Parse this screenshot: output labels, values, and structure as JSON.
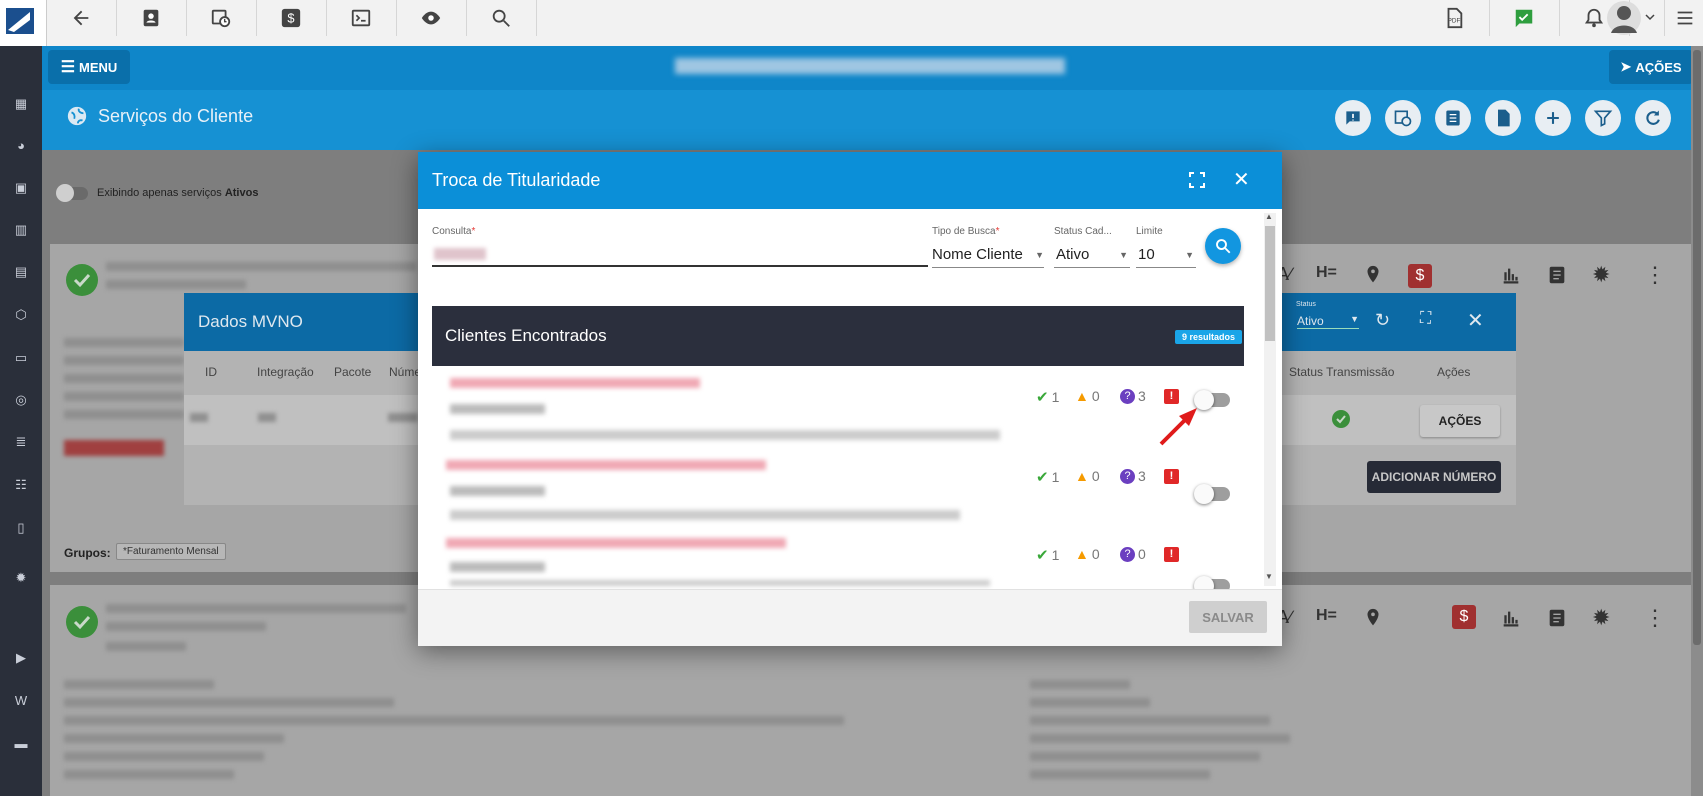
{
  "toolbar": {
    "icons": [
      "back-arrow-icon",
      "contact-card-icon",
      "calendar-clock-icon",
      "dollar-icon",
      "terminal-icon",
      "eye-icon",
      "search-icon"
    ],
    "right_icons": [
      "pdf-icon",
      "chat-check-icon",
      "bell-icon",
      "avatar",
      "menu-list-icon"
    ]
  },
  "header": {
    "menu_label": "MENU",
    "acoes_label": "AÇÕES",
    "page_title": "Serviços do Cliente"
  },
  "filter": {
    "toggle_text": "Exibindo apenas serviços",
    "toggle_bold": "Ativos"
  },
  "groups": {
    "label": "Grupos:",
    "tag": "*Faturamento Mensal"
  },
  "mvno": {
    "title": "Dados MVNO",
    "columns": [
      "ID",
      "Integração",
      "Pacote",
      "Núme"
    ],
    "status_label": "Status",
    "status_value": "Ativo",
    "status_tx_header": "Status Transmissão",
    "acoes_header": "Ações",
    "acoes_button": "AÇÕES",
    "add_button": "ADICIONAR NÚMERO"
  },
  "modal": {
    "title": "Troca de Titularidade",
    "consulta_label": "Consulta",
    "tipo_busca_label": "Tipo de Busca",
    "tipo_busca_value": "Nome Cliente",
    "status_cad_label": "Status Cad...",
    "status_cad_value": "Ativo",
    "limite_label": "Limite",
    "limite_value": "10",
    "results_title": "Clientes Encontrados",
    "results_badge": "9 resultados",
    "save_button": "SALVAR",
    "rows": [
      {
        "ok": "1",
        "warn": "0",
        "question": "3"
      },
      {
        "ok": "1",
        "warn": "0",
        "question": "3"
      },
      {
        "ok": "1",
        "warn": "0",
        "question": "0"
      }
    ]
  }
}
